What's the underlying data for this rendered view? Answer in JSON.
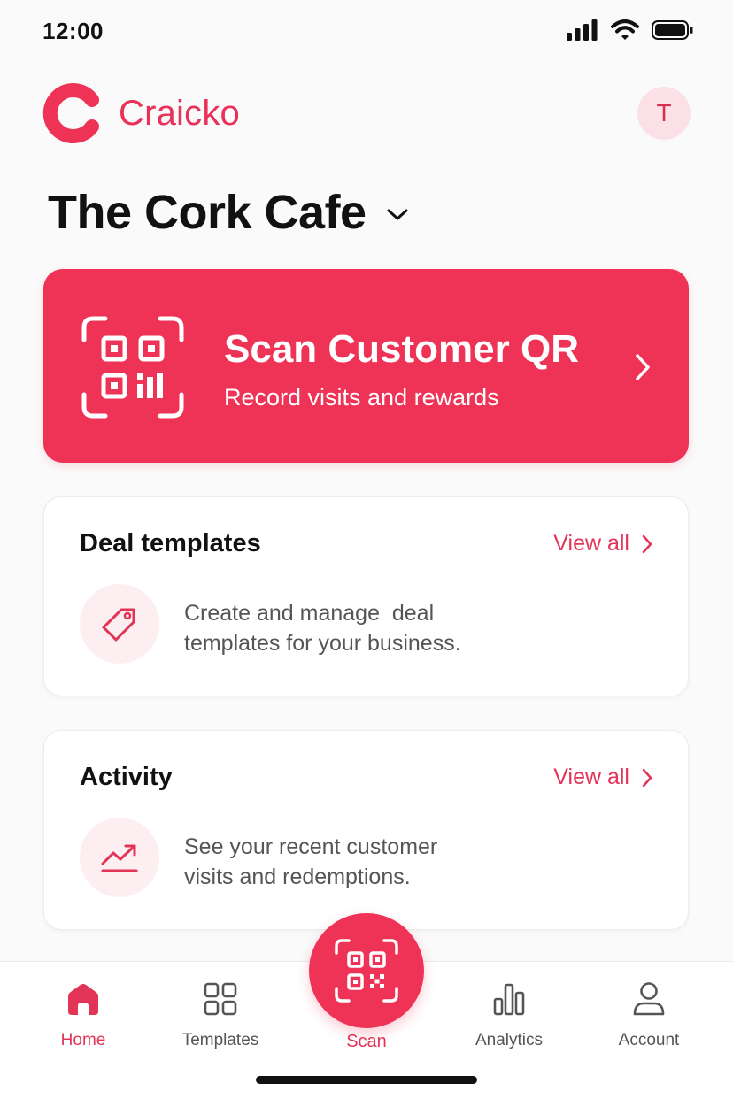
{
  "status_bar": {
    "time": "12:00"
  },
  "brand": {
    "name": "Craicko",
    "accent_color": "#ee3356"
  },
  "header": {
    "avatar_initial": "T"
  },
  "business": {
    "name": "The Cork Cafe"
  },
  "scan_card": {
    "title": "Scan Customer QR",
    "subtitle": "Record visits and rewards",
    "icon": "qr-code-icon"
  },
  "cards": [
    {
      "title": "Deal templates",
      "view_all": "View all",
      "icon": "tag-icon",
      "description_line1": "Create and manage  deal",
      "description_line2": "templates for your business."
    },
    {
      "title": "Activity",
      "view_all": "View all",
      "icon": "trending-up-icon",
      "description_line1": "See your recent customer",
      "description_line2": "visits and redemptions."
    }
  ],
  "bottom_nav": {
    "items": [
      {
        "label": "Home",
        "icon": "home-icon",
        "active": true
      },
      {
        "label": "Templates",
        "icon": "grid-icon",
        "active": false
      },
      {
        "label": "Scan",
        "icon": "qr-scan-icon",
        "active": false
      },
      {
        "label": "Analytics",
        "icon": "bar-chart-icon",
        "active": false
      },
      {
        "label": "Account",
        "icon": "user-icon",
        "active": false
      }
    ]
  }
}
